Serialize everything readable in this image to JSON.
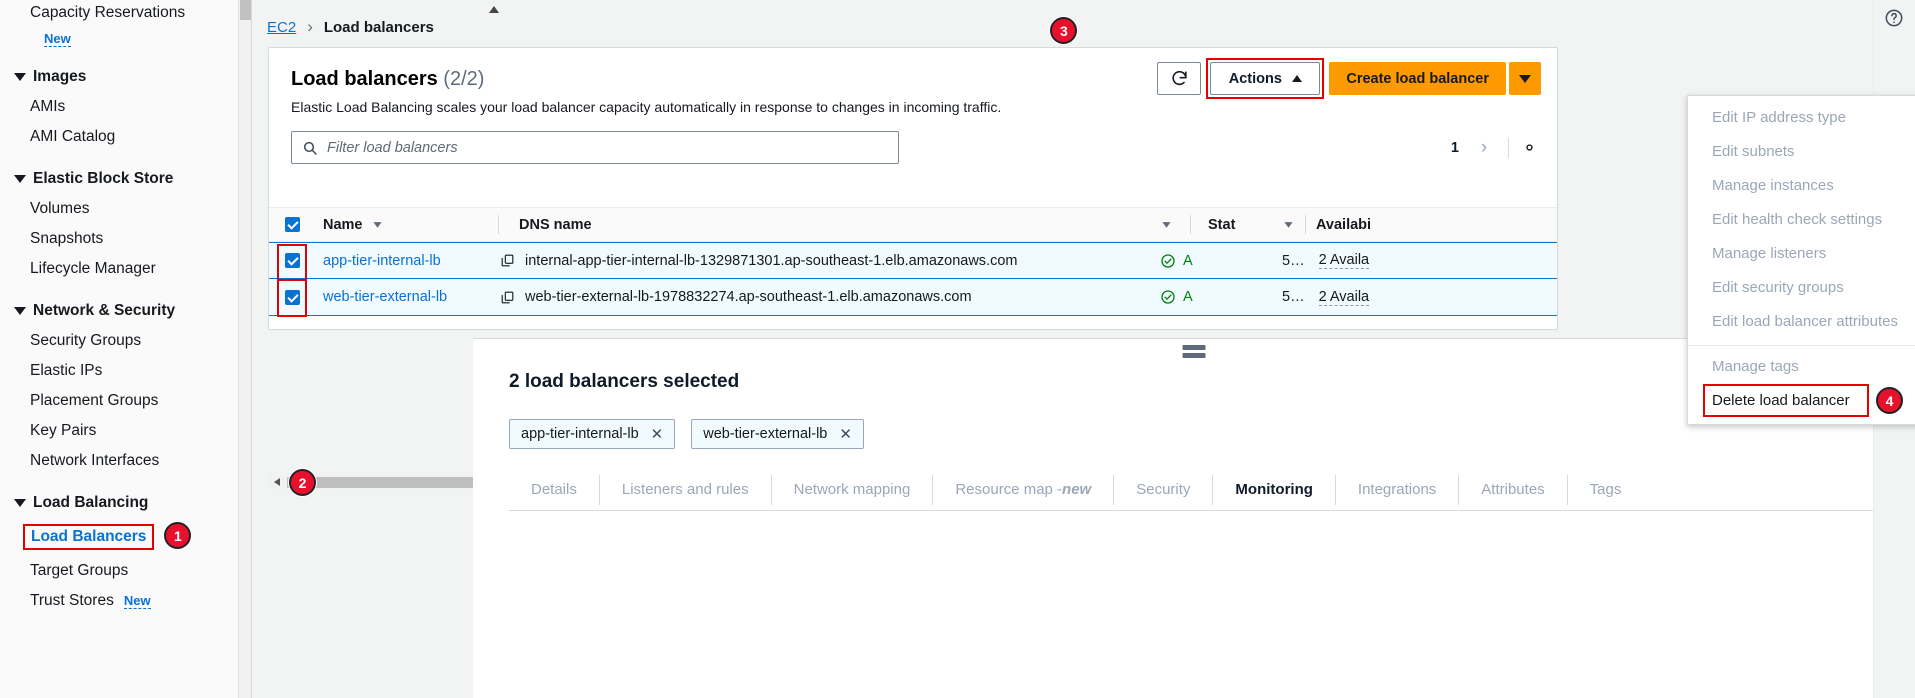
{
  "sidebar": {
    "items": [
      {
        "label": "Capacity Reservations",
        "type": "link",
        "badge": "New"
      },
      {
        "label": "Images",
        "type": "group"
      },
      {
        "label": "AMIs",
        "type": "link"
      },
      {
        "label": "AMI Catalog",
        "type": "link"
      },
      {
        "label": "Elastic Block Store",
        "type": "group"
      },
      {
        "label": "Volumes",
        "type": "link"
      },
      {
        "label": "Snapshots",
        "type": "link"
      },
      {
        "label": "Lifecycle Manager",
        "type": "link"
      },
      {
        "label": "Network & Security",
        "type": "group"
      },
      {
        "label": "Security Groups",
        "type": "link"
      },
      {
        "label": "Elastic IPs",
        "type": "link"
      },
      {
        "label": "Placement Groups",
        "type": "link"
      },
      {
        "label": "Key Pairs",
        "type": "link"
      },
      {
        "label": "Network Interfaces",
        "type": "link"
      },
      {
        "label": "Load Balancing",
        "type": "group"
      },
      {
        "label": "Load Balancers",
        "type": "link-selected"
      },
      {
        "label": "Target Groups",
        "type": "link"
      },
      {
        "label": "Trust Stores",
        "type": "link",
        "badge": "New"
      }
    ],
    "new_badge": "New",
    "selected_item": "Load Balancers",
    "selected_badge": "1"
  },
  "breadcrumb": {
    "root": "EC2",
    "separator": "›",
    "current": "Load balancers"
  },
  "card": {
    "title": "Load balancers",
    "count": "(2/2)",
    "description": "Elastic Load Balancing scales your load balancer capacity automatically in response to changes in incoming traffic.",
    "refresh_label": "refresh-icon",
    "actions_label": "Actions",
    "actions_badge": "3",
    "create_label": "Create load balancer"
  },
  "filter": {
    "placeholder": "Filter load balancers"
  },
  "pagination": {
    "page": "1",
    "next": "›",
    "settings": "gear-icon"
  },
  "table": {
    "columns": [
      "Name",
      "DNS name",
      "Stat",
      "Availabi"
    ],
    "select_all_checked": true,
    "rows_badge": "2",
    "rows": [
      {
        "selected": true,
        "name": "app-tier-internal-lb",
        "dns": "internal-app-tier-internal-lb-1329871301.ap-southeast-1.elb.amazonaws.com",
        "status": "A",
        "truncated": "5…",
        "az": "2 Availa"
      },
      {
        "selected": true,
        "name": "web-tier-external-lb",
        "dns": "web-tier-external-lb-1978832274.ap-southeast-1.elb.amazonaws.com",
        "status": "A",
        "truncated": "5…",
        "az": "2 Availa"
      }
    ]
  },
  "actions_menu": {
    "items": [
      {
        "label": "Edit IP address type",
        "enabled": false
      },
      {
        "label": "Edit subnets",
        "enabled": false
      },
      {
        "label": "Manage instances",
        "enabled": false
      },
      {
        "label": "Edit health check settings",
        "enabled": false
      },
      {
        "label": "Manage listeners",
        "enabled": false
      },
      {
        "label": "Edit security groups",
        "enabled": false
      },
      {
        "label": "Edit load balancer attributes",
        "enabled": false
      },
      {
        "label": "Manage tags",
        "enabled": false
      },
      {
        "label": "Delete load balancer",
        "enabled": true
      }
    ],
    "delete_badge": "4"
  },
  "split_panel": {
    "title": "2 load balancers selected",
    "close_label": "✕",
    "chips": [
      {
        "label": "app-tier-internal-lb",
        "remove": "✕"
      },
      {
        "label": "web-tier-external-lb",
        "remove": "✕"
      }
    ],
    "tabs": [
      {
        "label": "Details",
        "active": false
      },
      {
        "label": "Listeners and rules",
        "active": false
      },
      {
        "label": "Network mapping",
        "active": false
      },
      {
        "label": "Resource map - ",
        "suffix": "new",
        "active": false
      },
      {
        "label": "Security",
        "active": false
      },
      {
        "label": "Monitoring",
        "active": true
      },
      {
        "label": "Integrations",
        "active": false
      },
      {
        "label": "Attributes",
        "active": false
      },
      {
        "label": "Tags",
        "active": false
      }
    ]
  },
  "colors": {
    "accent": "#0972d3",
    "create_button": "#ff9900",
    "highlight": "#e60000",
    "badge": "#e8112d",
    "status_ok": "#037f0c",
    "row_selected": "#f1faff"
  }
}
